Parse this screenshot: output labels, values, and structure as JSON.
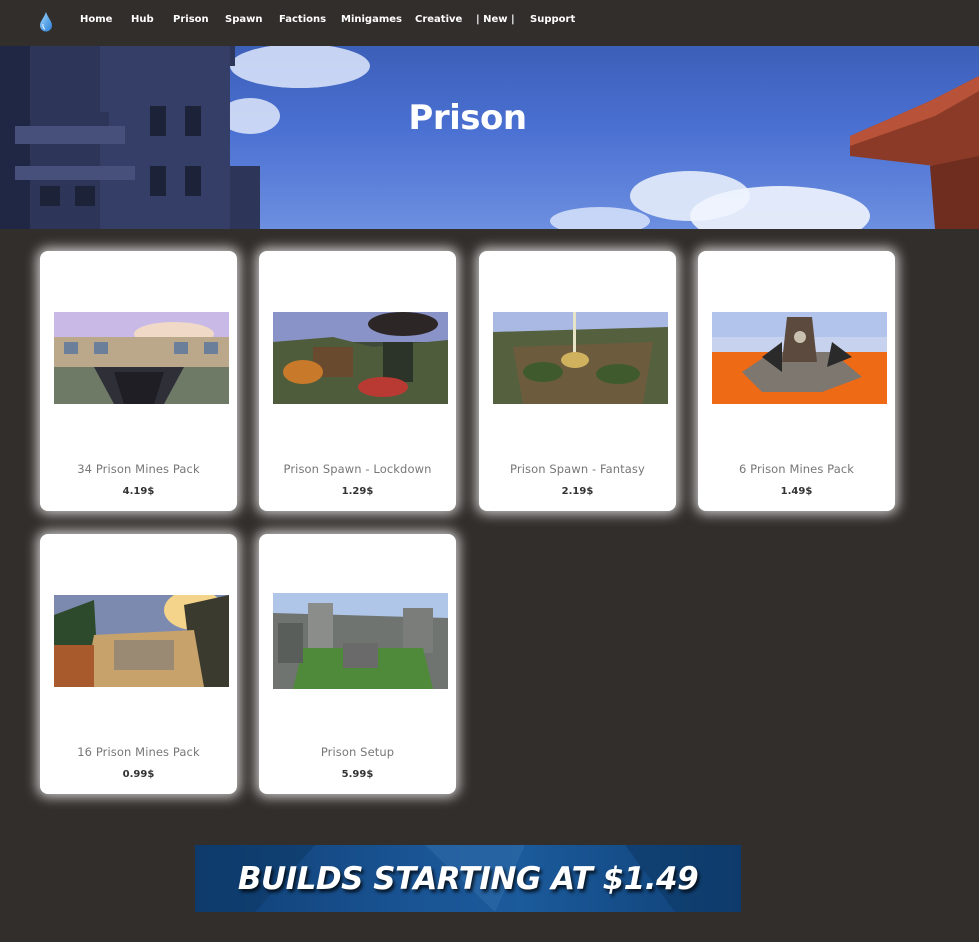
{
  "nav": {
    "items": [
      {
        "label": "Home"
      },
      {
        "label": "Hub"
      },
      {
        "label": "Prison"
      },
      {
        "label": "Spawn"
      },
      {
        "label": "Factions"
      },
      {
        "label": "Minigames"
      },
      {
        "label": "Creative"
      },
      {
        "label": "| New |"
      },
      {
        "label": "Support"
      }
    ],
    "logo_icon": "water-drop-icon"
  },
  "hero": {
    "title": "Prison"
  },
  "products": [
    {
      "title": "34 Prison Mines Pack",
      "price": "4.19$"
    },
    {
      "title": "Prison Spawn - Lockdown",
      "price": "1.29$"
    },
    {
      "title": "Prison Spawn - Fantasy",
      "price": "2.19$"
    },
    {
      "title": "6 Prison Mines Pack",
      "price": "1.49$"
    },
    {
      "title": "16 Prison Mines Pack",
      "price": "0.99$"
    },
    {
      "title": "Prison Setup",
      "price": "5.99$"
    }
  ],
  "banner": {
    "text": "BUILDS STARTING AT $1.49"
  },
  "colors": {
    "background": "#322e2b",
    "card": "#ffffff",
    "sky": "#4a70d2",
    "banner": "#1a5494"
  }
}
